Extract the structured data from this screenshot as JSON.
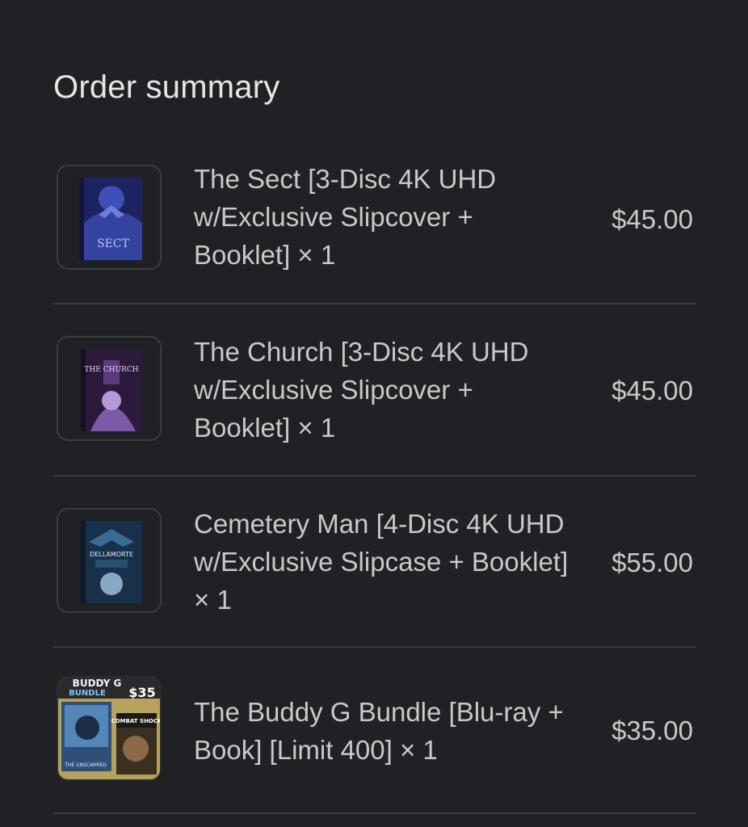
{
  "order_summary": {
    "title": "Order summary",
    "items": [
      {
        "name": "The Sect [3-Disc 4K UHD w/Exclusive Slipcover + Booklet] × 1",
        "price": "$45.00"
      },
      {
        "name": "The Church [3-Disc 4K UHD w/Exclusive Slipcover + Booklet] × 1",
        "price": "$45.00"
      },
      {
        "name": "Cemetery Man [4-Disc 4K UHD w/Exclusive Slipcase + Booklet] × 1",
        "price": "$55.00"
      },
      {
        "name": "The Buddy G Bundle [Blu-ray + Book] [Limit 400] × 1",
        "price": "$35.00"
      }
    ]
  },
  "thumbnails": {
    "sect_cover_text": "SECT",
    "church_cover_text": "THE CHURCH",
    "cemetery_cover_text": "DELLAMORTE",
    "bundle_header_text": "BUDDY G",
    "bundle_sub_text": "BUNDLE",
    "bundle_price_text": "$35",
    "bundle_right_text": "COMBAT SHOCK",
    "bundle_left_text": "THE UNSCARRED"
  }
}
